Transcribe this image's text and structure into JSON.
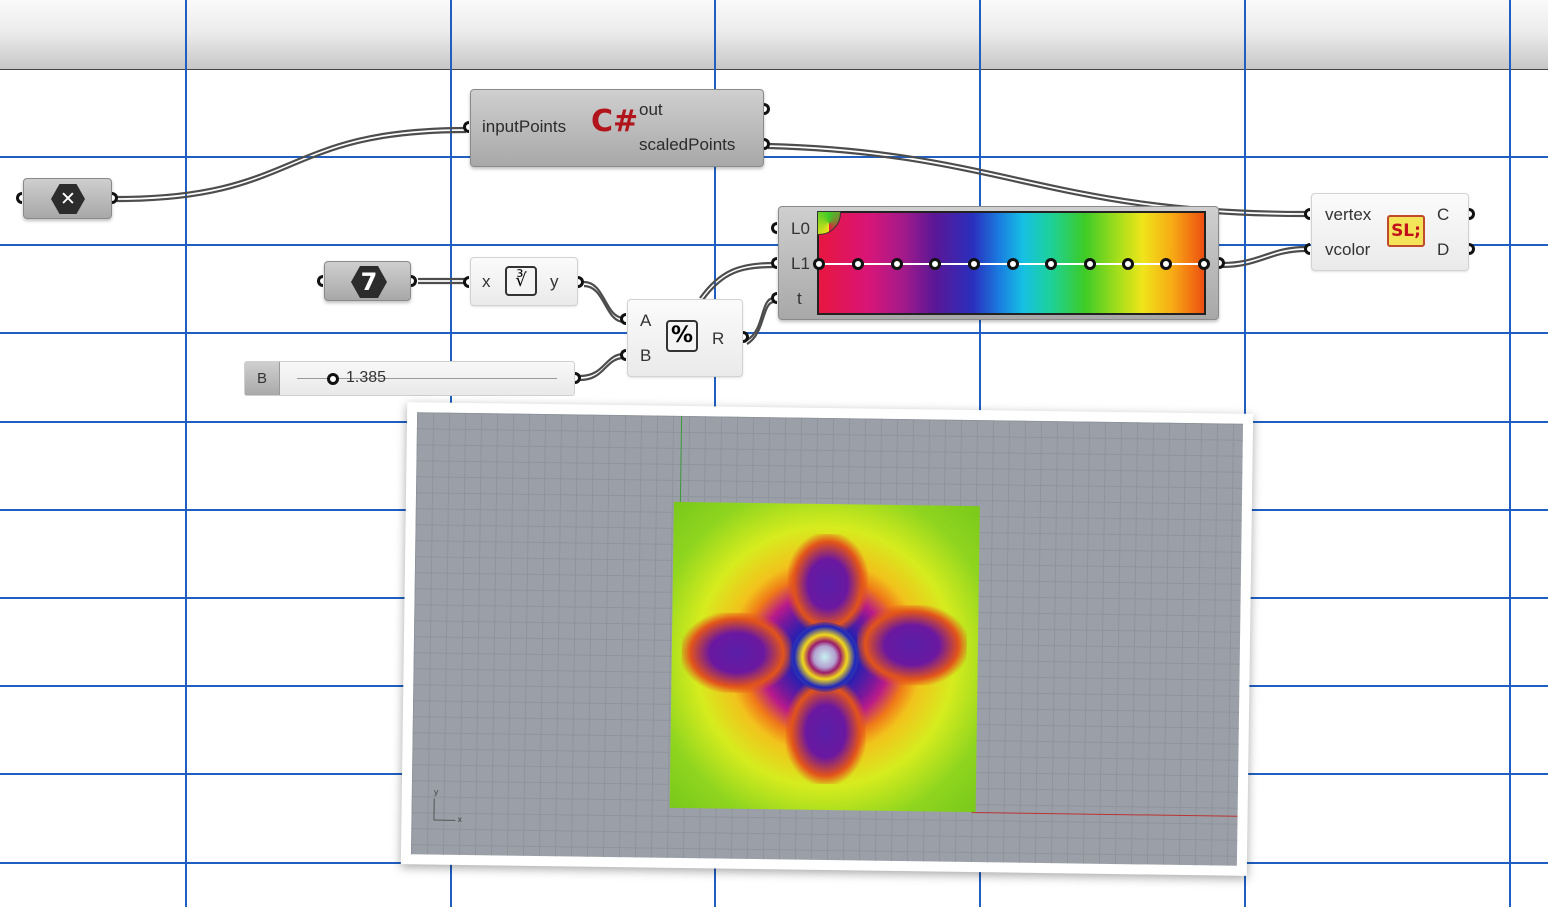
{
  "colors": {
    "grid_line": "#1f5fc1",
    "wire": "#555555",
    "node_dark": "#a8a8a8",
    "node_light": "#eeeeee",
    "gradient_stops": [
      "#e8163f",
      "#d81578",
      "#a21a8a",
      "#5b1796",
      "#2a2fbe",
      "#1a7ee0",
      "#16c0e3",
      "#1cd19c",
      "#3dcb27",
      "#a9de1b",
      "#efe51a",
      "#f7a814",
      "#ed4f11"
    ]
  },
  "csharp_node": {
    "input_label": "inputPoints",
    "icon": "csharp-icon",
    "icon_text": "C#",
    "outputs": [
      "out",
      "scaledPoints"
    ]
  },
  "clear_param": {
    "icon": "x-hexagon-icon",
    "symbol": "✕"
  },
  "integer_param": {
    "value": "7"
  },
  "cube_root_node": {
    "input_label": "x",
    "output_label": "y",
    "icon": "cube-root-icon",
    "icon_text": "∛"
  },
  "modulus_node": {
    "inputs": [
      "A",
      "B"
    ],
    "output_label": "R",
    "icon": "percent-icon",
    "icon_text": "%"
  },
  "slider": {
    "tag": "B",
    "value": "1.385"
  },
  "gradient_node": {
    "inputs": [
      "L0",
      "L1",
      "t"
    ],
    "grip_count": 11
  },
  "shader_node": {
    "inputs": [
      "vertex",
      "vcolor"
    ],
    "outputs": [
      "C",
      "D"
    ],
    "icon": "shader-icon",
    "icon_text": "SL;"
  },
  "viewport": {
    "axis_labels": [
      "y",
      "x"
    ]
  }
}
